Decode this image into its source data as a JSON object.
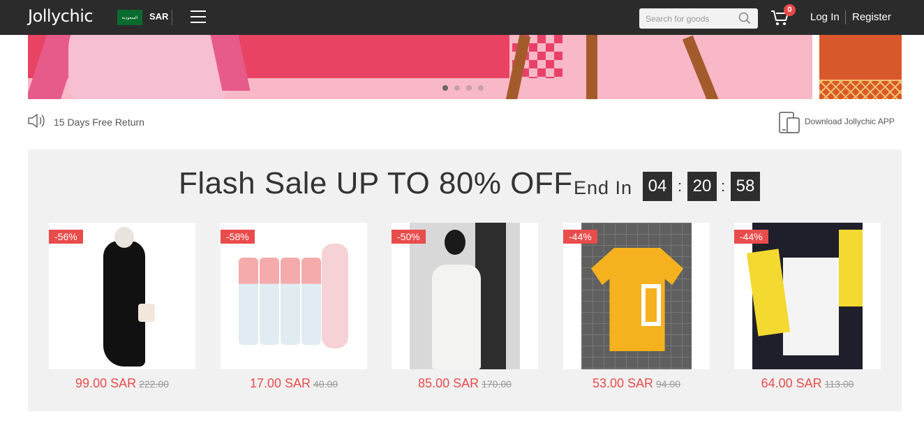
{
  "header": {
    "logo": "Jollychic",
    "flag_label": "السعودية",
    "currency": "SAR",
    "search_placeholder": "Search for goods",
    "cart_count": "0",
    "login": "Log In",
    "register": "Register"
  },
  "info": {
    "return_policy": "15 Days Free Return",
    "download_app": "Download Jollychic APP"
  },
  "flash_sale": {
    "title": "Flash Sale UP TO 80% OFF",
    "end_in_label": "End In",
    "timer": {
      "hours": "04",
      "minutes": "20",
      "seconds": "58"
    },
    "products": [
      {
        "discount": "-56%",
        "price": "99.00 SAR",
        "old_price": "222.00"
      },
      {
        "discount": "-58%",
        "price": "17.00 SAR",
        "old_price": "40.00"
      },
      {
        "discount": "-50%",
        "price": "85.00 SAR",
        "old_price": "170.00"
      },
      {
        "discount": "-44%",
        "price": "53.00 SAR",
        "old_price": "94.00"
      },
      {
        "discount": "-44%",
        "price": "64.00 SAR",
        "old_price": "113.00"
      }
    ]
  },
  "carousel": {
    "slide_count": 4,
    "active_index": 0
  },
  "colors": {
    "header_bg": "#2b2b2b",
    "accent_red": "#e94c4c",
    "section_bg": "#f1f1f1"
  }
}
